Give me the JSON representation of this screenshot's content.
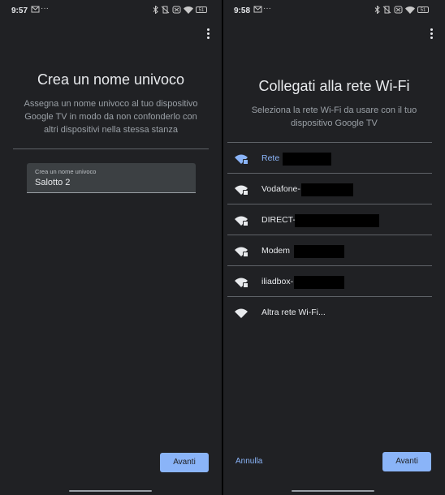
{
  "left": {
    "status": {
      "time": "9:57"
    },
    "title": "Crea un nome univoco",
    "description": "Assegna un nome univoco al tuo dispositivo Google TV in modo da non confonderlo con altri dispositivi nella stessa stanza",
    "field": {
      "label": "Crea un nome univoco",
      "value": "Salotto 2"
    },
    "next_label": "Avanti"
  },
  "right": {
    "status": {
      "time": "9:58"
    },
    "title": "Collegati alla rete Wi-Fi",
    "description": "Seleziona la rete Wi-Fi da usare con il tuo dispositivo Google TV",
    "networks": [
      {
        "ssid": "Rete",
        "secured": true,
        "selected": true,
        "redacted": true
      },
      {
        "ssid": "Vodafone-",
        "secured": true,
        "selected": false,
        "redacted": true
      },
      {
        "ssid": "DIRECT-",
        "secured": true,
        "selected": false,
        "redacted": true
      },
      {
        "ssid": "Modem",
        "secured": true,
        "selected": false,
        "redacted": true
      },
      {
        "ssid": "iliadbox-",
        "secured": true,
        "selected": false,
        "redacted": true
      },
      {
        "ssid": "Altra rete Wi-Fi...",
        "secured": false,
        "selected": false,
        "redacted": false
      }
    ],
    "cancel_label": "Annulla",
    "next_label": "Avanti"
  },
  "battery_level": "51",
  "icons": [
    "gmail-icon",
    "more-dots-icon",
    "bluetooth-icon",
    "vibrate-off-icon",
    "alarm-icon",
    "wifi-icon",
    "battery-icon",
    "overflow-menu-icon",
    "wifi-lock-icon",
    "wifi-icon"
  ],
  "colors": {
    "background": "#202124",
    "accent": "#8ab4f8",
    "text": "#e8eaed",
    "secondary_text": "#9aa0a6"
  }
}
